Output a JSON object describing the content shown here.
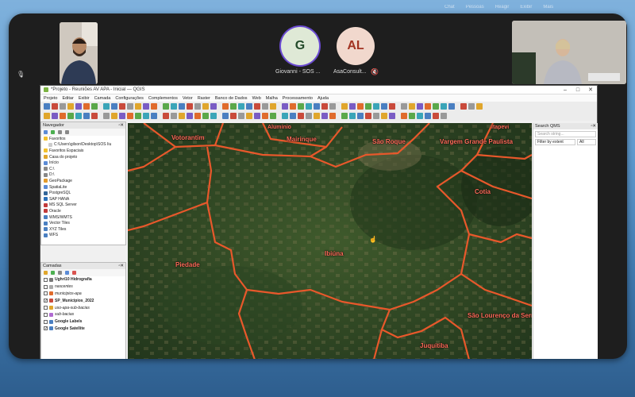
{
  "participants": [
    {
      "name": "Giovanni - SOS ...",
      "initial": "G",
      "color": "#dfe9d6",
      "fg": "#234a2a",
      "ring": "#6b4bd1"
    },
    {
      "name": "AsaConsult...",
      "initial": "AL",
      "color": "#f1d8cd",
      "fg": "#a23322"
    }
  ],
  "qgis": {
    "title": "*Projeto - Reuniões AV APA - Inicial — QGIS",
    "window_controls": [
      "–",
      "□",
      "✕"
    ],
    "menu": [
      "Projeto",
      "Editar",
      "Exibir",
      "Camada",
      "Configurações",
      "Complementos",
      "Vetor",
      "Raster",
      "Banco de Dados",
      "Web",
      "Malha",
      "Processamento",
      "Ajuda"
    ],
    "navigator": {
      "title": "Navegador",
      "items": [
        "Favoritos",
        "C:\\Users\\gilson\\Desktop\\SOS Iiu",
        "Favoritos Espaciais",
        "Casa do projeto",
        "Início",
        "C:\\",
        "D:\\",
        "GeoPackage",
        "SpatiaLite",
        "PostgreSQL",
        "SAP HANA",
        "MS SQL Server",
        "Oracle",
        "WMS/WMTS",
        "Vector Tiles",
        "XYZ Tiles",
        "WFS"
      ]
    },
    "layers": {
      "title": "Camadas",
      "items": [
        {
          "label": "Ughri10 Hidrografia",
          "bold": true,
          "checked": false
        },
        {
          "label": "nascentes",
          "bold": false,
          "checked": false
        },
        {
          "label": "municipios-apa",
          "bold": false,
          "checked": false
        },
        {
          "label": "SP_Municipios_2022",
          "bold": true,
          "checked": true
        },
        {
          "label": "uso-apa-sub-bacias",
          "bold": false,
          "checked": false
        },
        {
          "label": "sub-bacias",
          "bold": false,
          "checked": false
        },
        {
          "label": "Google Labels",
          "bold": true,
          "checked": false
        },
        {
          "label": "Google Satellite",
          "bold": true,
          "checked": true
        }
      ]
    },
    "search": {
      "title": "Search QMS",
      "placeholder": "Search string...",
      "filter_label": "Filter by extent",
      "filter_value": "All"
    },
    "map_labels": [
      "Votorantim",
      "Mairinque",
      "São Roque",
      "Vargem Grande Paulista",
      "Cotia",
      "Piedade",
      "Ibiúna",
      "São Lourenço da Serra",
      "Juquitiba",
      "Alumínio",
      "Itapevi"
    ]
  },
  "colors": {
    "boundary": "#e8582b",
    "label": "#ff6d5a"
  }
}
